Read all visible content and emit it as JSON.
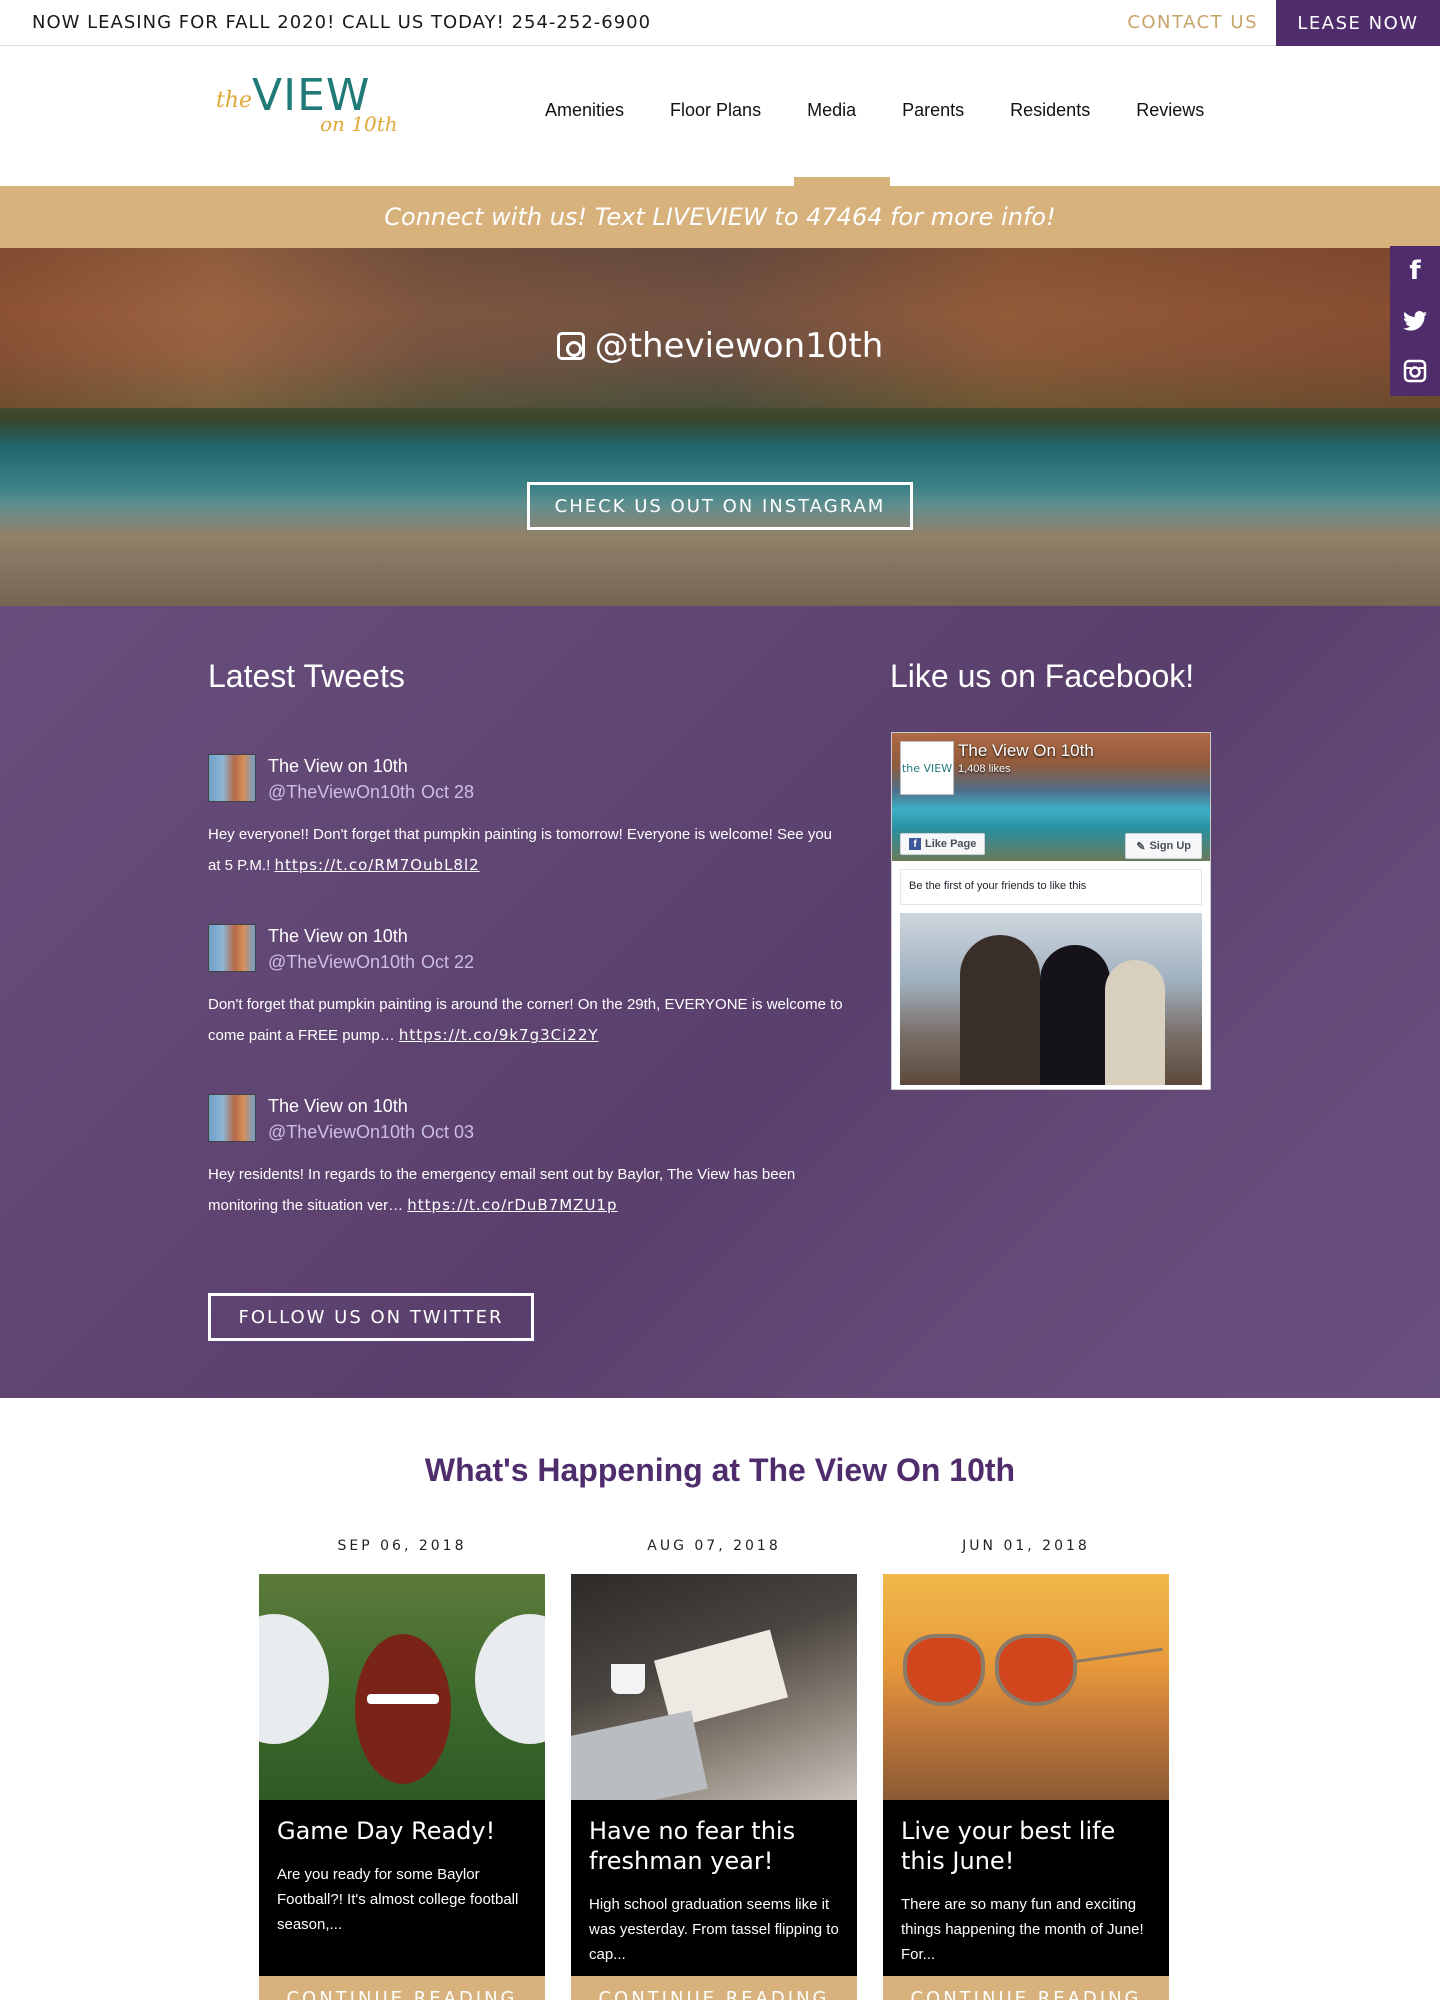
{
  "topbar": {
    "announcement": "NOW LEASING FOR FALL 2020! CALL US TODAY! 254-252-6900",
    "contact_label": "CONTACT US",
    "lease_label": "LEASE NOW"
  },
  "logo": {
    "the": "the",
    "view": "VIEW",
    "on10": "on 10th"
  },
  "nav": {
    "items": [
      "Amenities",
      "Floor Plans",
      "Media",
      "Parents",
      "Residents",
      "Reviews"
    ],
    "active": "Media"
  },
  "promo": {
    "text": "Connect with us! Text LIVEVIEW to 47464 for more info!"
  },
  "side_social": {
    "icons": [
      "facebook-icon",
      "twitter-icon",
      "instagram-icon"
    ]
  },
  "instagram": {
    "handle": "@theviewon10th",
    "cta_label": "CHECK US OUT ON INSTAGRAM"
  },
  "twitter": {
    "title": "Latest Tweets",
    "tweets": [
      {
        "name": "The View on 10th",
        "handle": "@TheViewOn10th",
        "date": "Oct 28",
        "text": "Hey everyone!! Don't forget that pumpkin painting is tomorrow! Everyone is welcome! See you at 5 P.M.!",
        "link": "https://t.co/RM7OubL8l2"
      },
      {
        "name": "The View on 10th",
        "handle": "@TheViewOn10th",
        "date": "Oct 22",
        "text": "Don't forget that pumpkin painting is around the corner! On the 29th, EVERYONE is welcome to come paint a FREE pump…",
        "link": "https://t.co/9k7g3Ci22Y"
      },
      {
        "name": "The View on 10th",
        "handle": "@TheViewOn10th",
        "date": "Oct 03",
        "text": "Hey residents! In regards to the emergency email sent out by Baylor, The View has been monitoring the situation ver…",
        "link": "https://t.co/rDuB7MZU1p"
      }
    ],
    "follow_label": "FOLLOW US ON TWITTER"
  },
  "facebook": {
    "title": "Like us on Facebook!",
    "page_name": "The View On 10th",
    "likes": "1,408 likes",
    "like_label": "Like Page",
    "signup_label": "Sign Up",
    "friends_text": "Be the first of your friends to like this",
    "logo_text": "the VIEW"
  },
  "blog": {
    "title": "What's Happening at The View On 10th",
    "posts": [
      {
        "date": "SEP 06, 2018",
        "title": "Game Day Ready!",
        "excerpt": "Are you ready for some Baylor Football?!  It's almost college football season,...",
        "cta": "CONTINUE READING"
      },
      {
        "date": "AUG 07, 2018",
        "title": "Have no fear this freshman year!",
        "excerpt": "High school graduation seems like it was yesterday. From tassel flipping to cap...",
        "cta": "CONTINUE READING"
      },
      {
        "date": "JUN 01, 2018",
        "title": "Live your best life this June!",
        "excerpt": "There are so many fun and exciting things happening the month of June! For...",
        "cta": "CONTINUE READING"
      }
    ]
  },
  "colors": {
    "purple": "#4f2d6c",
    "gold": "#d7b27c",
    "teal": "#1f7a78"
  }
}
